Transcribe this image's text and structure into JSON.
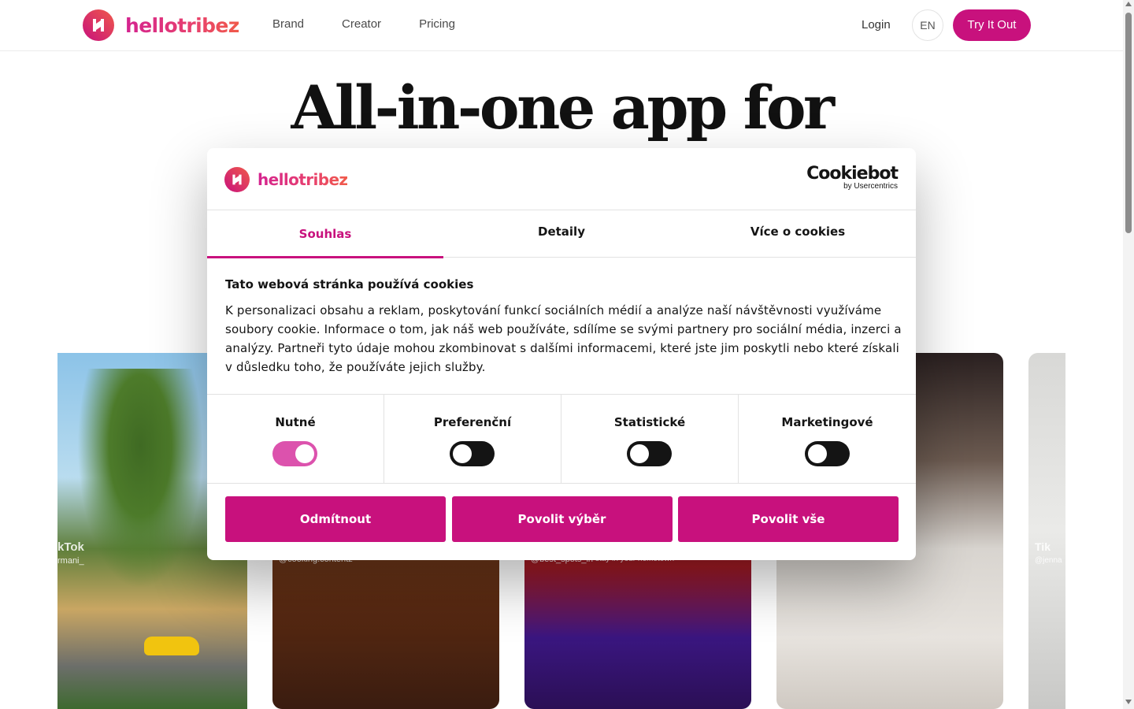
{
  "brand": {
    "name": "hellotribez",
    "accent": "#c8117d"
  },
  "nav": {
    "items": [
      "Brand",
      "Creator",
      "Pricing"
    ]
  },
  "header": {
    "login": "Login",
    "lang": "EN",
    "cta": "Try It Out"
  },
  "hero": {
    "title": "All-in-one app for"
  },
  "cards": {
    "card1": {
      "name": "kTok",
      "handle": "rmani_"
    },
    "card2": {
      "handle": "@cooking.contentz"
    },
    "card3": {
      "handle": "@best_spots_in",
      "caption": "stay in your hometown"
    },
    "card5": {
      "name": "Tik",
      "handle": "@jenna"
    }
  },
  "cookie": {
    "brand": "hellotribez",
    "provider": "Cookiebot",
    "provider_sub": "by Usercentrics",
    "tabs": [
      "Souhlas",
      "Detaily",
      "Více o cookies"
    ],
    "active_tab": "Souhlas",
    "title": "Tato webová stránka používá cookies",
    "text": "K personalizaci obsahu a reklam, poskytování funkcí sociálních médií a analýze naší návštěvnosti využíváme soubory cookie. Informace o tom, jak náš web používáte, sdílíme se svými partnery pro sociální média, inzerci a analýzy. Partneři tyto údaje mohou zkombinovat s dalšími informacemi, které jste jim poskytli nebo které získali v důsledku toho, že používáte jejich služby.",
    "categories": [
      {
        "label": "Nutné",
        "enabled": true
      },
      {
        "label": "Preferenční",
        "enabled": false
      },
      {
        "label": "Statistické",
        "enabled": false
      },
      {
        "label": "Marketingové",
        "enabled": false
      }
    ],
    "buttons": {
      "reject": "Odmítnout",
      "allow_selection": "Povolit výběr",
      "allow_all": "Povolit vše"
    }
  }
}
